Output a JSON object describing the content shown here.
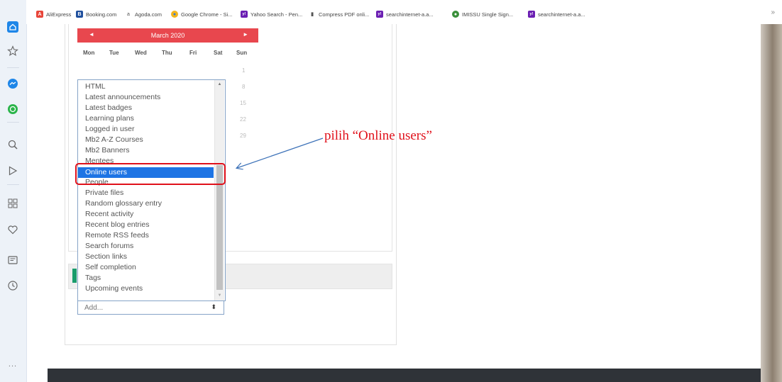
{
  "bookmarks": [
    {
      "label": "AliExpress",
      "color": "#e8463a",
      "icon": "aliexpress-icon",
      "glyph": "A"
    },
    {
      "label": "Booking.com",
      "color": "#1f4f9d",
      "icon": "booking-icon",
      "glyph": "B"
    },
    {
      "label": "Agoda.com",
      "color": "#ffffff",
      "icon": "agoda-icon",
      "glyph": "a"
    },
    {
      "label": "Google Chrome - Si...",
      "color": "#f2b41c",
      "icon": "chrome-icon",
      "glyph": "●"
    },
    {
      "label": "Yahoo Search - Pen...",
      "color": "#6b1fb2",
      "icon": "yahoo-icon",
      "glyph": "y!"
    },
    {
      "label": "Compress PDF onli...",
      "color": "#555555",
      "icon": "document-icon",
      "glyph": "▮"
    },
    {
      "label": "searchinternet-a.a...",
      "color": "#6b1fb2",
      "icon": "yahoo-icon",
      "glyph": "y!"
    },
    {
      "label": "IMISSU Single Sign...",
      "color": "#3a8f3a",
      "icon": "imissu-icon",
      "glyph": "●"
    },
    {
      "label": "searchinternet-a.a...",
      "color": "#6b1fb2",
      "icon": "yahoo-icon",
      "glyph": "y!"
    }
  ],
  "bookmarks_more": "»",
  "sidebar_more": "...",
  "calendar": {
    "prev": "◄",
    "title": "March 2020",
    "next": "►",
    "days": [
      "Mon",
      "Tue",
      "Wed",
      "Thu",
      "Fri",
      "Sat",
      "Sun"
    ],
    "visible_dates": [
      "1",
      "8",
      "15",
      "22",
      "29"
    ]
  },
  "block_list": {
    "options": [
      "HTML",
      "Latest announcements",
      "Latest badges",
      "Learning plans",
      "Logged in user",
      "Mb2 A-Z Courses",
      "Mb2 Banners",
      "Mentees",
      "Online users",
      "People",
      "Private files",
      "Random glossary entry",
      "Recent activity",
      "Recent blog entries",
      "Remote RSS feeds",
      "Search forums",
      "Section links",
      "Self completion",
      "Tags",
      "Upcoming events"
    ],
    "selected": "Online users",
    "scroll_up": "▲",
    "scroll_down": "▼"
  },
  "add_select": {
    "value": "Add...",
    "arrow": "⬍"
  },
  "annotation": {
    "text": "pilih “Online users”",
    "color": "#e0101a"
  },
  "colors": {
    "calendar_header": "#e8474e",
    "selection": "#1e74e4",
    "green_chip": "#1a9c6c"
  }
}
